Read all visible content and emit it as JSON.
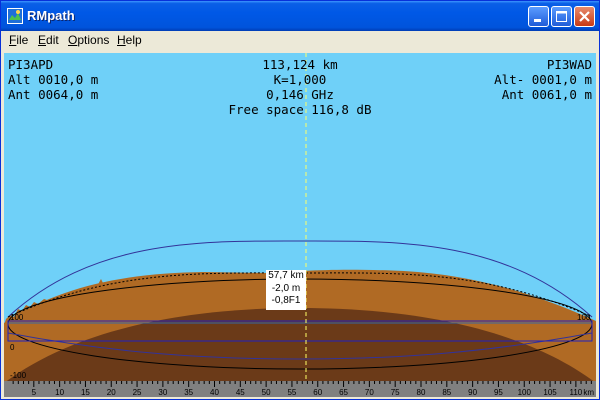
{
  "window": {
    "title": "RMpath"
  },
  "menu": [
    {
      "label_hot": "F",
      "label_rest": "ile"
    },
    {
      "label_hot": "E",
      "label_rest": "dit"
    },
    {
      "label_hot": "O",
      "label_rest": "ptions"
    },
    {
      "label_hot": "H",
      "label_rest": "elp"
    }
  ],
  "header": {
    "left_station": "PI3APD",
    "left_alt": "Alt 0010,0 m",
    "left_ant": "Ant 0064,0 m",
    "right_station": "PI3WAD",
    "right_alt": "Alt- 0001,0 m",
    "right_ant": "Ant 0061,0 m",
    "distance": "113,124 km",
    "k_factor": "K=1,000",
    "frequency": "0,146 GHz",
    "free_space": "Free space 116,8 dB"
  },
  "midpoint": {
    "distance": "57,7 km",
    "height": "-2,0 m",
    "fresnel": "-0,8F1"
  },
  "side_labels": {
    "left_top": "100",
    "left_mid": "0",
    "left_bot": "-100",
    "right_top": "100"
  },
  "axis": {
    "unit": "km",
    "range_km": [
      0,
      113.124
    ],
    "ticks": [
      5,
      10,
      15,
      20,
      25,
      30,
      35,
      40,
      45,
      50,
      55,
      60,
      65,
      70,
      75,
      80,
      85,
      90,
      95,
      100,
      105,
      110
    ]
  },
  "colors": {
    "sky": "#6fd0f8",
    "terrain": "#b06a24",
    "earth": "#6b3a18",
    "axis_bg": "#808080",
    "midline": "#ffff66"
  }
}
